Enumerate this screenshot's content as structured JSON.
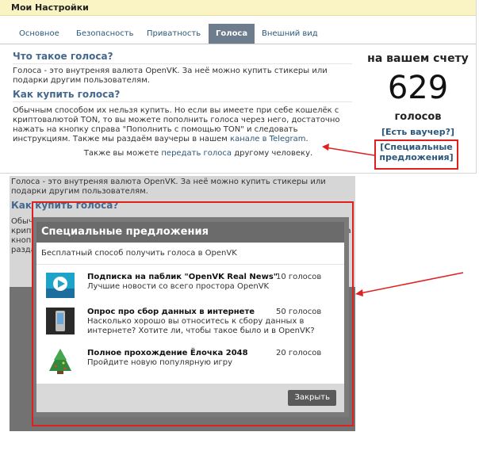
{
  "page": {
    "title": "Мои Настройки"
  },
  "tabs": [
    {
      "label": "Основное"
    },
    {
      "label": "Безопасность"
    },
    {
      "label": "Приватность"
    },
    {
      "label": "Голоса"
    },
    {
      "label": "Внешний вид"
    }
  ],
  "main": {
    "what_title": "Что такое голоса?",
    "what_text": "Голоса - это внутреняя валюта OpenVK. За неё можно купить стикеры или подарки другим пользователям.",
    "buy_title": "Как купить голоса?",
    "buy_text_1": "Обычным способом их нельзя купить. Но если вы имеете при себе кошелёк с криптовалютой TON, то вы можете пополнить голоса через него, достаточно нажать на кнопку справа \"Пополнить с помощью TON\" и следовать инструкциям. Также мы раздаём ваучеры в нашем",
    "buy_link": "канале в Telegram",
    "buy_text_2": ".",
    "transfer_pre": "Также вы можете",
    "transfer_link": "передать голоса",
    "transfer_post": "другому человеку."
  },
  "balance": {
    "title": "на вашем счету",
    "amount": "629",
    "unit": "голосов",
    "voucher_link": "[Есть ваучер?]",
    "offers_link_1": "[Специальные",
    "offers_link_2": "предложения]"
  },
  "lower_bg": {
    "what_text": "Голоса - это внутреняя валюта OpenVK. За неё можно купить стикеры или подарки другим пользователям.",
    "buy_title": "Как купить голоса?",
    "frag1": "Обыч",
    "frag2": "крипт",
    "frag3": "кнопк",
    "frag4": "разда",
    "frag5": "на"
  },
  "modal": {
    "title": "Специальные предложения",
    "subtitle": "Бесплатный способ получить голоса в OpenVK",
    "offers": [
      {
        "title": "Подписка на паблик \"OpenVK Real News\"",
        "amount": "10 голосов",
        "desc": "Лучшие новости со всего простора OpenVK"
      },
      {
        "title": "Опрос про сбор данных в интернете",
        "amount": "50 голосов",
        "desc": "Насколько хорошо вы относитесь к сбору данных в интернете? Хотите ли, чтобы такое было и в OpenVK?"
      },
      {
        "title": "Полное прохождение Ёлочка 2048",
        "amount": "20 голосов",
        "desc": "Пройдите новую популярную игру"
      }
    ],
    "close_label": "Закрыть"
  },
  "colors": {
    "accent": "#2b587a",
    "header_bg": "#faf3c4",
    "tab_active": "#6d7d8d",
    "annotation": "#e02020"
  }
}
